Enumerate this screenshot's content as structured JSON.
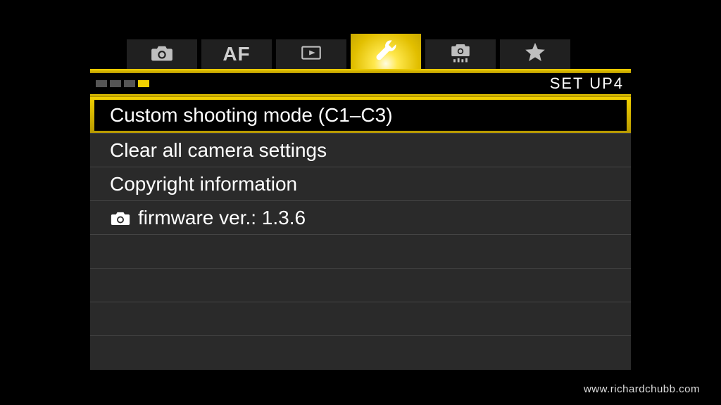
{
  "tabs": {
    "items": [
      {
        "name": "shoot",
        "icon": "camera-icon"
      },
      {
        "name": "af",
        "text": "AF"
      },
      {
        "name": "playback",
        "icon": "play-icon"
      },
      {
        "name": "setup",
        "icon": "wrench-icon",
        "active": true
      },
      {
        "name": "custom",
        "icon": "camera-dots-icon"
      },
      {
        "name": "mymenu",
        "icon": "star-icon"
      }
    ]
  },
  "subheader": {
    "page_index": 4,
    "page_count": 4,
    "label": "SET UP4"
  },
  "menu": {
    "items": [
      {
        "label": "Custom shooting mode (C1–C3)",
        "selected": true
      },
      {
        "label": "Clear all camera settings"
      },
      {
        "label": "Copyright information"
      },
      {
        "label": "firmware ver.: 1.3.6",
        "has_camera_icon": true
      }
    ],
    "total_rows": 8
  },
  "watermark": "www.richardchubb.com"
}
